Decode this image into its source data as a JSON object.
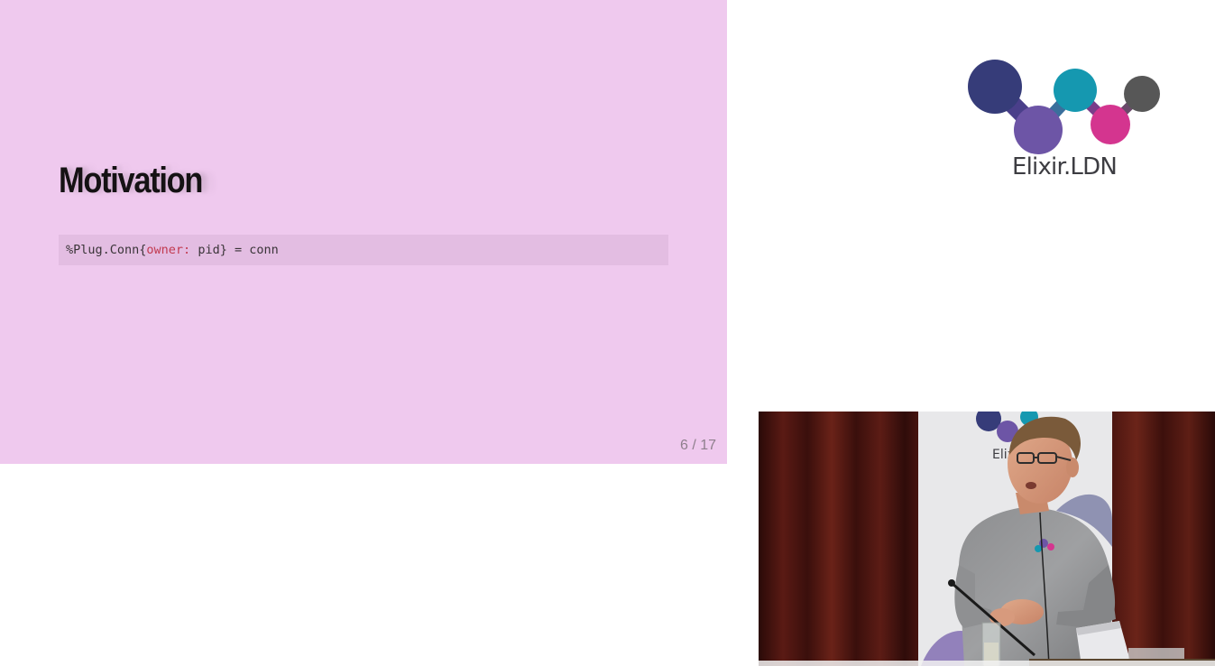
{
  "slide": {
    "title": "Motivation",
    "code": {
      "prefix": "%Plug.Conn{",
      "key": "owner:",
      "suffix": " pid} = conn"
    },
    "counter": "6 / 17",
    "background_color": "#efc9ee"
  },
  "logo": {
    "text": "Elixir.LDN",
    "icon": "elixir-ldn-dots-icon",
    "colors": [
      "#363c79",
      "#6d55a6",
      "#1598b0",
      "#d4358f",
      "#575757"
    ]
  },
  "video": {
    "description_icon": "speaker-video",
    "banner_text": "Elixir"
  }
}
